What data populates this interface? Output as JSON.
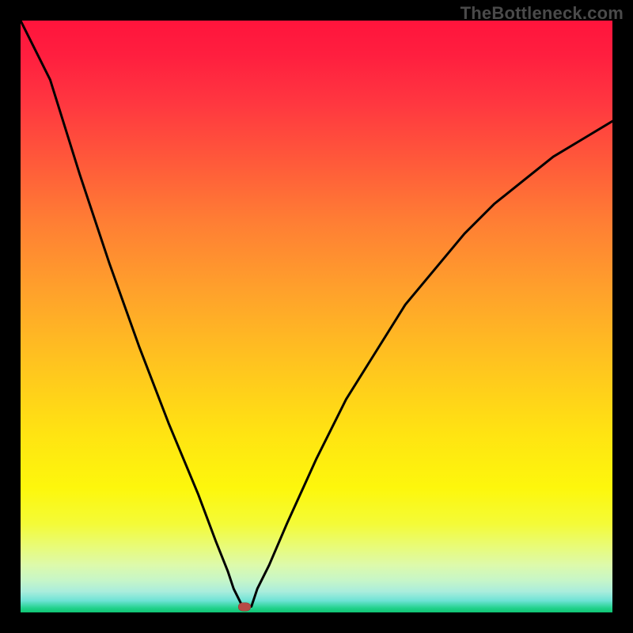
{
  "watermark": "TheBottleneck.com",
  "colors": {
    "frame_border": "#000000",
    "curve_stroke": "#000000",
    "marker_fill": "#b64b45",
    "gradient_top": "#ff143c",
    "gradient_bottom": "#0fc574"
  },
  "chart_data": {
    "type": "line",
    "title": "",
    "xlabel": "",
    "ylabel": "",
    "xlim": [
      0,
      100
    ],
    "ylim": [
      0,
      100
    ],
    "annotations": [
      {
        "name": "watermark",
        "text": "TheBottleneck.com",
        "position": "top-right"
      }
    ],
    "series": [
      {
        "name": "curve",
        "x": [
          0,
          5,
          10,
          15,
          20,
          25,
          30,
          33,
          35,
          36,
          37.5,
          39,
          40,
          42,
          45,
          50,
          55,
          60,
          65,
          70,
          75,
          80,
          85,
          90,
          95,
          100
        ],
        "values": [
          108,
          90,
          74,
          59,
          45,
          32,
          20,
          12,
          7,
          4,
          1,
          1,
          4,
          8,
          15,
          26,
          36,
          44,
          52,
          58,
          64,
          69,
          73,
          77,
          80,
          83
        ]
      }
    ],
    "flat_bottom": {
      "x_start": 36.0,
      "x_end": 39.0,
      "y": 1.0
    },
    "marker": {
      "x": 37.8,
      "y": 1.0,
      "shape": "rounded-ellipse"
    },
    "background_gradient": {
      "direction": "top-to-bottom",
      "stops": [
        {
          "offset": 0.0,
          "color": "#ff143c"
        },
        {
          "offset": 0.24,
          "color": "#ff5a3a"
        },
        {
          "offset": 0.46,
          "color": "#ffa22b"
        },
        {
          "offset": 0.7,
          "color": "#ffe412"
        },
        {
          "offset": 0.85,
          "color": "#f4fb37"
        },
        {
          "offset": 0.95,
          "color": "#c7f6c7"
        },
        {
          "offset": 1.0,
          "color": "#0fc574"
        }
      ]
    }
  }
}
